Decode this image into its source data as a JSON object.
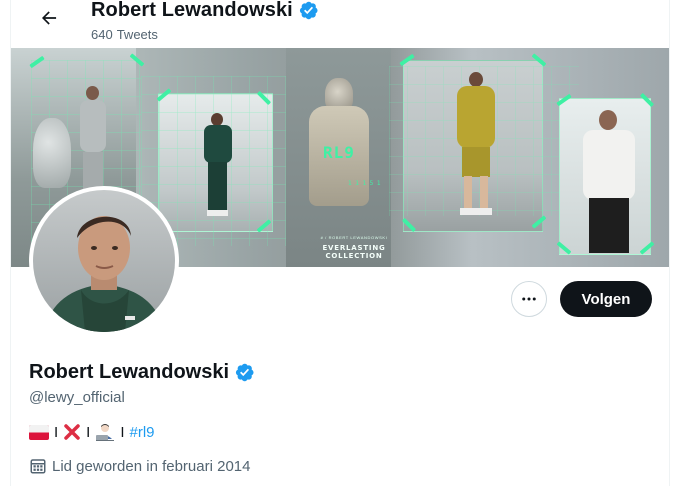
{
  "header": {
    "name": "Robert Lewandowski",
    "tweet_count": "640",
    "tweet_label": "Tweets"
  },
  "banner": {
    "logo_text": "RL9",
    "code_text": "1 1 1 5 1",
    "tagline_small": "# / ROBERT LEWANDOWSKI",
    "collection": "EVERLASTING COLLECTION"
  },
  "actions": {
    "follow_label": "Volgen"
  },
  "profile": {
    "name": "Robert Lewandowski",
    "handle": "@lewy_official",
    "bio": {
      "separator": "I",
      "hashtag": "#rl9"
    },
    "joined": "Lid geworden in februari 2014"
  },
  "colors": {
    "accent": "#1d9bf0",
    "verified": "#1d9bf0",
    "banner_accent": "#3ff0a4",
    "follow_bg": "#0f1419"
  },
  "icons": [
    "back-arrow-icon",
    "verified-badge-icon",
    "more-icon",
    "calendar-icon",
    "poland-flag-icon",
    "cross-mark-icon",
    "man-technologist-icon"
  ]
}
